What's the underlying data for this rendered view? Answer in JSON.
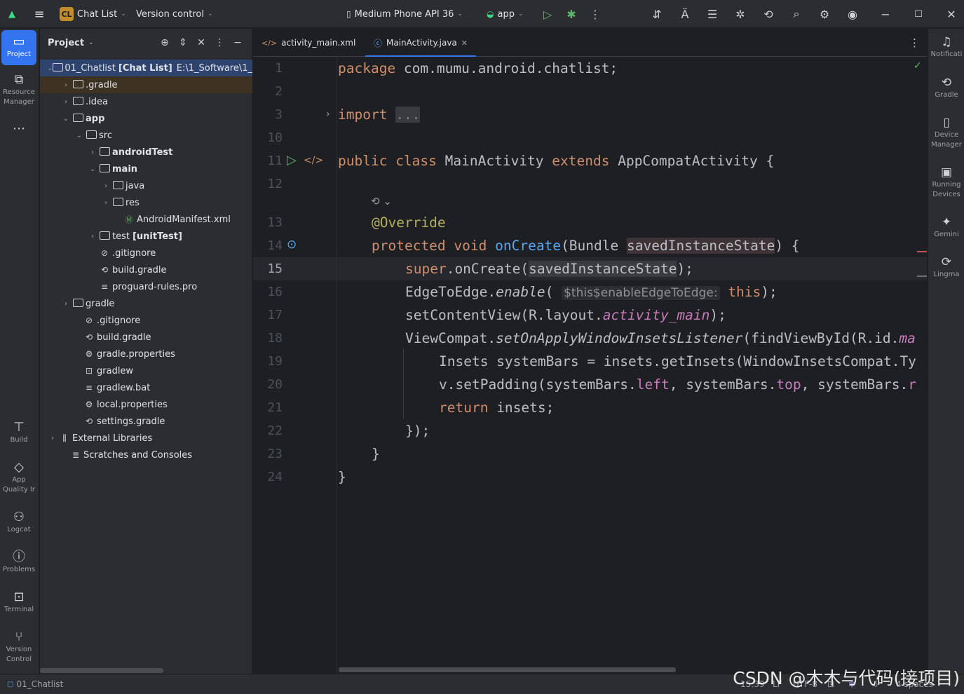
{
  "titlebar": {
    "project_badge": "CL",
    "project_name": "Chat List",
    "vcs": "Version control",
    "device": "Medium Phone API 36",
    "run_config": "app"
  },
  "left_strip": [
    {
      "label": "Project",
      "icon": "folder-icon",
      "active": true
    },
    {
      "label": "Resource Manager",
      "icon": "resource-manager-icon"
    },
    {
      "label": "Build",
      "icon": "hammer-icon"
    },
    {
      "label": "App Quality Ir",
      "icon": "diamond-icon"
    },
    {
      "label": "Logcat",
      "icon": "logcat-icon"
    },
    {
      "label": "Problems",
      "icon": "problems-icon"
    },
    {
      "label": "Terminal",
      "icon": "terminal-icon"
    },
    {
      "label": "Version Control",
      "icon": "version-control-icon"
    }
  ],
  "project_panel": {
    "title": "Project",
    "root_name": "01_Chatlist",
    "root_module": "[Chat List]",
    "root_path": "E:\\1_Software\\1_And",
    "tree": [
      {
        "label": ".gradle"
      },
      {
        "label": ".idea"
      },
      {
        "label": "app"
      },
      {
        "label": "src"
      },
      {
        "label": "androidTest"
      },
      {
        "label": "main"
      },
      {
        "label": "java"
      },
      {
        "label": "res"
      },
      {
        "label": "AndroidManifest.xml"
      },
      {
        "label": "test",
        "suffix": "[unitTest]"
      },
      {
        "label": ".gitignore"
      },
      {
        "label": "build.gradle"
      },
      {
        "label": "proguard-rules.pro"
      },
      {
        "label": "gradle"
      },
      {
        "label": ".gitignore"
      },
      {
        "label": "build.gradle"
      },
      {
        "label": "gradle.properties"
      },
      {
        "label": "gradlew"
      },
      {
        "label": "gradlew.bat"
      },
      {
        "label": "local.properties"
      },
      {
        "label": "settings.gradle"
      },
      {
        "label": "External Libraries"
      },
      {
        "label": "Scratches and Consoles"
      }
    ]
  },
  "tabs": [
    {
      "label": "activity_main.xml",
      "active": false
    },
    {
      "label": "MainActivity.java",
      "active": true
    }
  ],
  "editor": {
    "line_numbers": [
      "1",
      "2",
      "3",
      "10",
      "11",
      "12",
      "13",
      "14",
      "15",
      "16",
      "17",
      "18",
      "19",
      "20",
      "21",
      "22",
      "23",
      "24"
    ],
    "current_line": "15",
    "code": {
      "l1_kw": "package",
      "l1_rest": " com.mumu.android.chatlist;",
      "l3_kw": "import",
      "l3_fold": "...",
      "l11_kw1": "public",
      "l11_kw2": "class",
      "l11_name": " MainActivity ",
      "l11_kw3": "extends",
      "l11_rest": " AppCompatActivity {",
      "l13_ann": "@Override",
      "l14_kw1": "protected",
      "l14_kw2": "void",
      "l14_fn": "onCreate",
      "l14_p1": "(Bundle ",
      "l14_param": "savedInstanceState",
      "l14_p2": ") {",
      "l15_kw": "super",
      "l15_p1": ".onCreate(",
      "l15_param": "savedInstanceState",
      "l15_p2": ");",
      "l16_p1": "EdgeToEdge.",
      "l16_st": "enable",
      "l16_p2": "(",
      "l16_hint": "$this$enableEdgeToEdge:",
      "l16_kw": "this",
      "l16_p3": ");",
      "l17_p1": "setContentView(R.layout.",
      "l17_field": "activity_main",
      "l17_p2": ");",
      "l18_p1": "ViewCompat.",
      "l18_st": "setOnApplyWindowInsetsListener",
      "l18_p2": "(findViewById(R.id.",
      "l18_field": "ma",
      "l19": "Insets systemBars = insets.getInsets(WindowInsetsCompat.Ty",
      "l20_p1": "v.setPadding(systemBars.",
      "l20_f1": "left",
      "l20_p2": ", systemBars.",
      "l20_f2": "top",
      "l20_p3": ", systemBars.",
      "l20_f3": "r",
      "l21_kw": "return",
      "l21_rest": " insets;",
      "l22": "});",
      "l23": "}",
      "l24": "}"
    }
  },
  "right_strip": [
    {
      "label": "Notificati",
      "icon": "bell-icon"
    },
    {
      "label": "Gradle",
      "icon": "gradle-icon"
    },
    {
      "label": "Device Manager",
      "icon": "device-manager-icon"
    },
    {
      "label": "Running Devices",
      "icon": "running-devices-icon"
    },
    {
      "label": "Gemini",
      "icon": "gemini-icon"
    },
    {
      "label": "Lingma",
      "icon": "lingma-icon"
    }
  ],
  "statusbar": {
    "breadcrumb": "01_Chatlist",
    "position": "15:39",
    "line_sep": "LF",
    "encoding": "UTF-8",
    "indent": "4 spaces"
  },
  "watermark": "CSDN @木木与代码(接项目)",
  "colors": {
    "accent": "#3574f0",
    "keyword": "#cf8e6d",
    "function": "#56a8f5",
    "annotation": "#b3ae60",
    "field": "#c77dbb"
  }
}
